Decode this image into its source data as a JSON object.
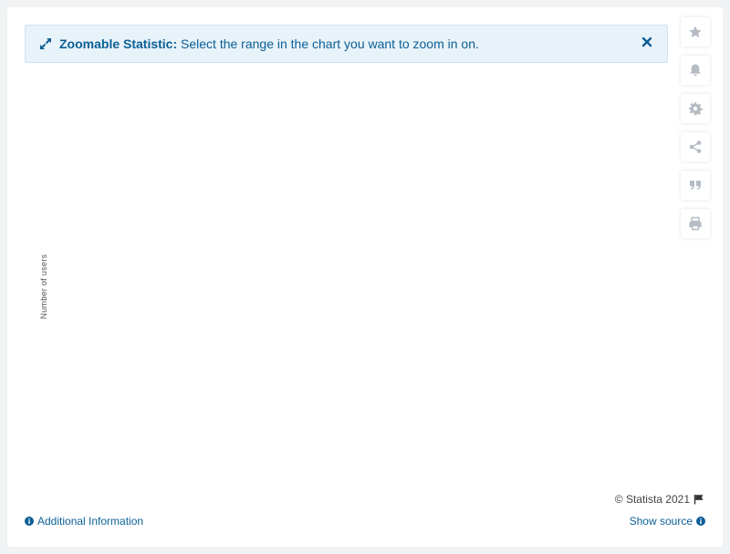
{
  "banner": {
    "title": "Zoomable Statistic:",
    "message": "Select the range in the chart you want to zoom in on.",
    "expand_icon": "expand-arrows-icon",
    "close_icon": "close-icon"
  },
  "toolbar": {
    "items": [
      {
        "name": "favorite",
        "icon": "star-icon"
      },
      {
        "name": "notification",
        "icon": "bell-icon"
      },
      {
        "name": "settings",
        "icon": "gear-icon"
      },
      {
        "name": "share",
        "icon": "share-icon"
      },
      {
        "name": "cite",
        "icon": "quote-icon"
      },
      {
        "name": "print",
        "icon": "print-icon"
      }
    ]
  },
  "chart": {
    "ylabel": "Number of users"
  },
  "footer": {
    "copyright": "© Statista 2021",
    "additional_info": "Additional Information",
    "show_source": "Show source"
  },
  "colors": {
    "accent": "#0b5f96",
    "banner_bg": "#e8f2f9",
    "icon_gray": "#b5bcc4"
  }
}
